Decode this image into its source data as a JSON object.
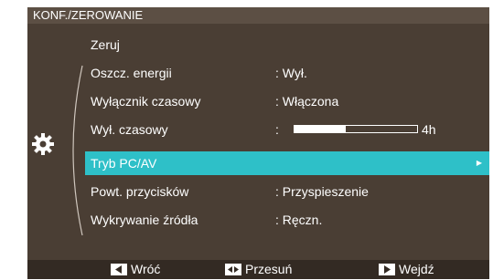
{
  "title": "KONF./ZEROWANIE",
  "menu": [
    {
      "label": "Zeruj",
      "value": ""
    },
    {
      "label": "Oszcz. energii",
      "value": ":  Wył."
    },
    {
      "label": "Wyłącznik czasowy",
      "value": ":  Włączona"
    },
    {
      "label": "Wył. czasowy",
      "value": ":",
      "slider_fraction": 0.42,
      "slider_text": "4h"
    },
    {
      "label": "Tryb PC/AV",
      "value": "",
      "selected": true
    },
    {
      "label": "Powt. przycisków",
      "value": ":  Przyspieszenie"
    },
    {
      "label": "Wykrywanie źródła",
      "value": ":  Ręczn."
    }
  ],
  "footer": {
    "back": "Wróć",
    "move": "Przesuń",
    "enter": "Wejdź"
  },
  "icons": {
    "category": "gear-icon",
    "back": "left-arrow-key-icon",
    "move": "up-down-arrow-key-icon",
    "enter": "right-arrow-key-icon"
  },
  "colors": {
    "background": "#4a3e34",
    "title_bar": "#5c4f44",
    "footer_bar": "#332a23",
    "selected": "#2ec0c8",
    "text": "#ffffff"
  }
}
